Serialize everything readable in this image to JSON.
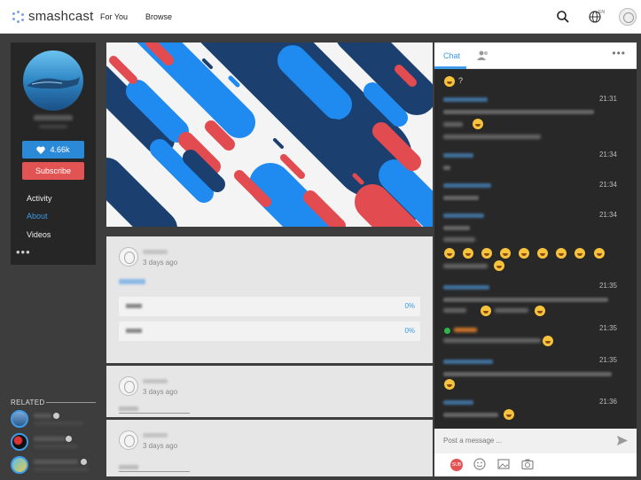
{
  "header": {
    "brand": "smashcast",
    "nav": [
      "For You",
      "Browse"
    ],
    "lang_code": "EN"
  },
  "profile": {
    "likes": "4.66k",
    "subscribe": "Subscribe",
    "menu": [
      "Activity",
      "About",
      "Videos"
    ],
    "active_menu": "About",
    "more": "•••"
  },
  "related": {
    "title": "RELATED"
  },
  "posts": [
    {
      "date": "3 days ago",
      "poll": [
        {
          "pct": "0%"
        },
        {
          "pct": "0%"
        }
      ]
    },
    {
      "date": "3 days ago"
    },
    {
      "date": "3 days ago"
    }
  ],
  "chat": {
    "tab": "Chat",
    "more": "•••",
    "first_line": "?",
    "times": [
      "21:31",
      "21:34",
      "21:34",
      "21:34",
      "21:35",
      "21:35",
      "21:35",
      "21:36"
    ],
    "input_placeholder": "Post a message ...",
    "sub_badge": "SUB"
  },
  "colors": {
    "accent": "#3d9be9",
    "subscribe": "#e25353",
    "chat_bg": "#282828"
  }
}
